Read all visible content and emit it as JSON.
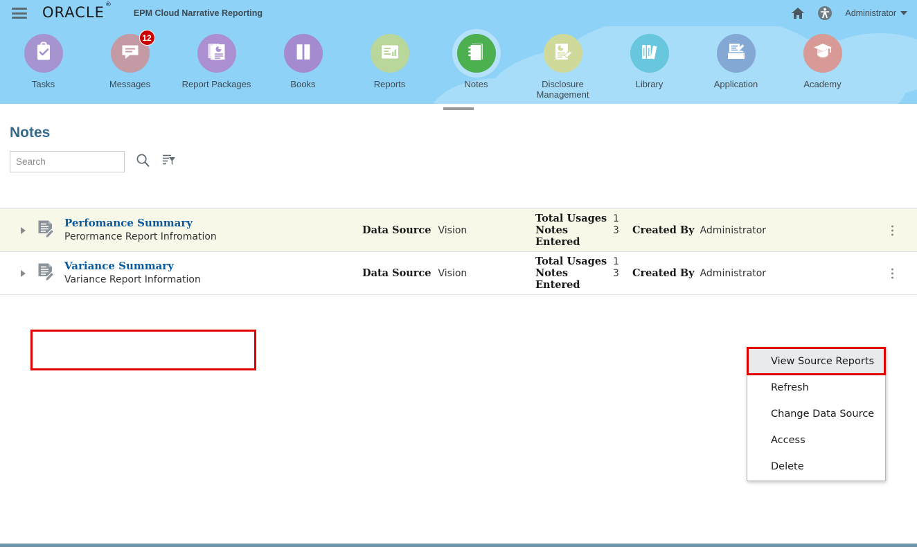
{
  "header": {
    "menu_icon": "hamburger-icon",
    "brand": "ORACLE",
    "brand_mark": "®",
    "app_title": "EPM Cloud Narrative Reporting",
    "home_icon": "home-icon",
    "accessibility_icon": "accessibility-icon",
    "user": "Administrator"
  },
  "nav": {
    "items": [
      {
        "label": "Tasks",
        "icon": "clipboard-check-icon",
        "color": "#a694d0",
        "selected": false,
        "badge": null
      },
      {
        "label": "Messages",
        "icon": "speech-bubble-icon",
        "color": "#c49aa4",
        "selected": false,
        "badge": "12"
      },
      {
        "label": "Report Packages",
        "icon": "report-stack-icon",
        "color": "#ab8fd1",
        "selected": false,
        "badge": null
      },
      {
        "label": "Books",
        "icon": "book-icon",
        "color": "#a48bd0",
        "selected": false,
        "badge": null
      },
      {
        "label": "Reports",
        "icon": "report-chart-icon",
        "color": "#b9d79a",
        "selected": false,
        "badge": null
      },
      {
        "label": "Notes",
        "icon": "notebook-icon",
        "color": "#4caf50",
        "selected": true,
        "badge": null
      },
      {
        "label": "Disclosure Management",
        "icon": "disclosure-tag-icon",
        "color": "#cfd99a",
        "selected": false,
        "badge": null
      },
      {
        "label": "Library",
        "icon": "library-books-icon",
        "color": "#68c6dd",
        "selected": false,
        "badge": null
      },
      {
        "label": "Application",
        "icon": "app-box-icon",
        "color": "#83a8d4",
        "selected": false,
        "badge": null
      },
      {
        "label": "Academy",
        "icon": "graduation-cap-icon",
        "color": "#d79a96",
        "selected": false,
        "badge": null
      }
    ]
  },
  "page": {
    "title": "Notes",
    "search_placeholder": "Search",
    "search_value": "",
    "search_icon": "magnifier-icon",
    "filter_icon": "filter-list-icon",
    "settings_icon": "gear-icon"
  },
  "list": {
    "rows": [
      {
        "name": "Perfomance Summary",
        "description": "Perormance Report Infromation",
        "data_source_label": "Data Source",
        "data_source_value": "Vision",
        "total_usages_label": "Total Usages",
        "total_usages_value": "1",
        "notes_entered_label": "Notes Entered",
        "notes_entered_value": "3",
        "created_by_label": "Created By",
        "created_by_value": "Administrator",
        "selected": true
      },
      {
        "name": "Variance Summary",
        "description": "Variance Report Information",
        "data_source_label": "Data Source",
        "data_source_value": "Vision",
        "total_usages_label": "Total Usages",
        "total_usages_value": "1",
        "notes_entered_label": "Notes Entered",
        "notes_entered_value": "3",
        "created_by_label": "Created By",
        "created_by_value": "Administrator",
        "selected": false
      }
    ]
  },
  "context_menu": {
    "items": [
      {
        "label": "View Source Reports",
        "hovered": true
      },
      {
        "label": "Refresh",
        "hovered": false
      },
      {
        "label": "Change Data Source",
        "hovered": false
      },
      {
        "label": "Access",
        "hovered": false
      },
      {
        "label": "Delete",
        "hovered": false
      }
    ]
  },
  "colors": {
    "header_blue": "#8fd2f7",
    "cloud_blue": "#a8ddf9",
    "title_blue": "#34698c",
    "link_blue": "#0a5a9c",
    "selected_row": "#f8f8e9",
    "annotation_red": "#e00000",
    "badge_red": "#cc0000",
    "bottom_bar": "#6f93ab"
  }
}
